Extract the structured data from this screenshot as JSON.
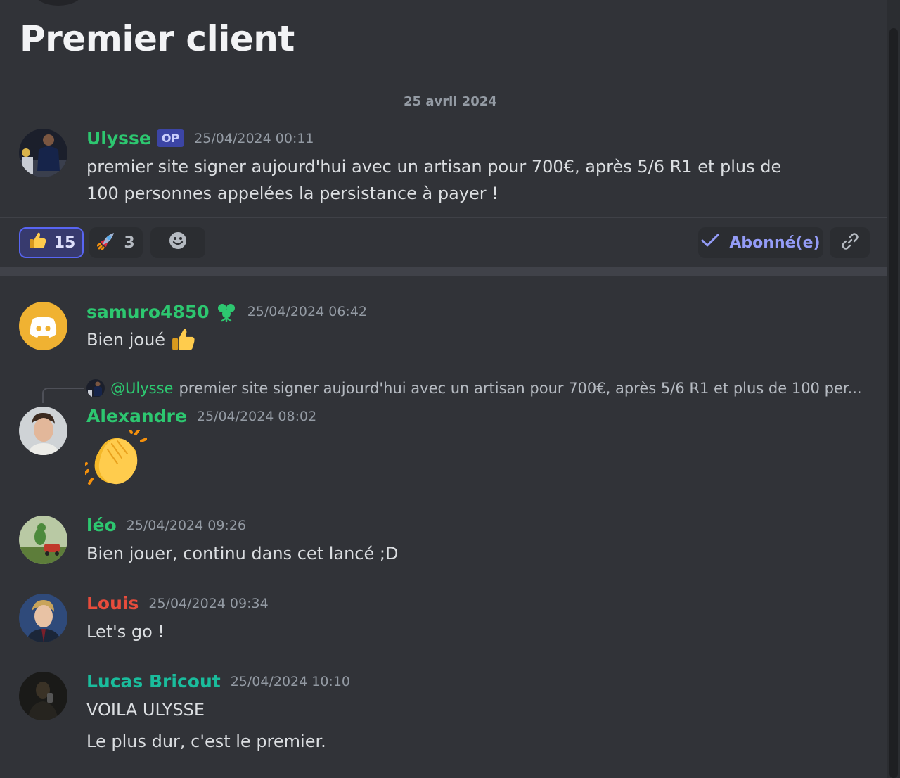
{
  "thread": {
    "title": "Premier client",
    "date_divider": "25 avril 2024"
  },
  "colors": {
    "green": "#2dc770",
    "teal": "#1abc9c",
    "red": "#e74c3c",
    "blurple": "#5865f2"
  },
  "original_post": {
    "author": "Ulysse",
    "badge": "OP",
    "timestamp": "25/04/2024 00:11",
    "text": "premier site signer aujourd'hui avec un artisan pour 700€, après 5/6 R1 et plus de 100 personnes appelées la persistance à payer !"
  },
  "reactions": [
    {
      "icon": "thumbs-up-icon",
      "count": "15",
      "active": true
    },
    {
      "icon": "rocket-icon",
      "count": "3",
      "active": false
    }
  ],
  "actions": {
    "follow_label": "Abonné(e)"
  },
  "replies": [
    {
      "author": "samuro4850",
      "timestamp": "25/04/2024 06:42",
      "text": "Bien joué",
      "badge_icon": "clover-icon"
    },
    {
      "author": "Alexandre",
      "timestamp": "25/04/2024 08:02",
      "reply_to": {
        "mention": "@Ulysse",
        "preview": "premier site signer aujourd'hui avec un artisan pour 700€, après 5/6 R1 et plus de 100 per..."
      },
      "emoji": "clapping-hands-icon"
    },
    {
      "author": "léo",
      "timestamp": "25/04/2024 09:26",
      "text": "Bien jouer, continu dans cet lancé ;D"
    },
    {
      "author": "Louis",
      "timestamp": "25/04/2024 09:34",
      "text": "Let's go !"
    },
    {
      "author": "Lucas Bricout",
      "timestamp": "25/04/2024 10:10",
      "text": "VOILA ULYSSE",
      "text2": "Le plus dur, c'est le premier."
    }
  ]
}
